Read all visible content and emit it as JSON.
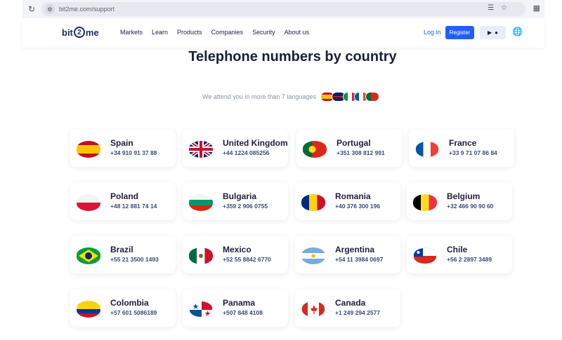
{
  "browser": {
    "url": "bit2me.com/support"
  },
  "header": {
    "logo_left": "bit",
    "logo_mid": "2",
    "logo_right": "me",
    "menu": [
      "Markets",
      "Learn",
      "Products",
      "Companies",
      "Security",
      "About us"
    ],
    "login": "Log in",
    "register": "Register"
  },
  "main": {
    "title": "Telephone numbers by country",
    "languages_text": "We attend you in more than 7 languages",
    "countries": [
      {
        "name": "Spain",
        "phone": "+34 910 91 37 88"
      },
      {
        "name": "United Kingdom",
        "phone": "+44 1224 085256"
      },
      {
        "name": "Portugal",
        "phone": "+351 308 812 991"
      },
      {
        "name": "France",
        "phone": "+33 9 71 07 86 84"
      },
      {
        "name": "Poland",
        "phone": "+48 12 881 74 14"
      },
      {
        "name": "Bulgaria",
        "phone": "+359 2 906 0755"
      },
      {
        "name": "Romania",
        "phone": "+40 376 300 196"
      },
      {
        "name": "Belgium",
        "phone": "+32 466 90 90 60"
      },
      {
        "name": "Brazil",
        "phone": "+55 21 3500 1493"
      },
      {
        "name": "Mexico",
        "phone": "+52 55 8842 6770"
      },
      {
        "name": "Argentina",
        "phone": "+54 11 3984 0697"
      },
      {
        "name": "Chile",
        "phone": "+56 2 2897 3489"
      },
      {
        "name": "Colombia",
        "phone": "+57 601 5086189"
      },
      {
        "name": "Panama",
        "phone": "+507 848 4108"
      },
      {
        "name": "Canada",
        "phone": "+1 249 294 2577"
      }
    ]
  },
  "colors": {
    "accent": "#1f5fff",
    "text": "#1b1f3b"
  }
}
